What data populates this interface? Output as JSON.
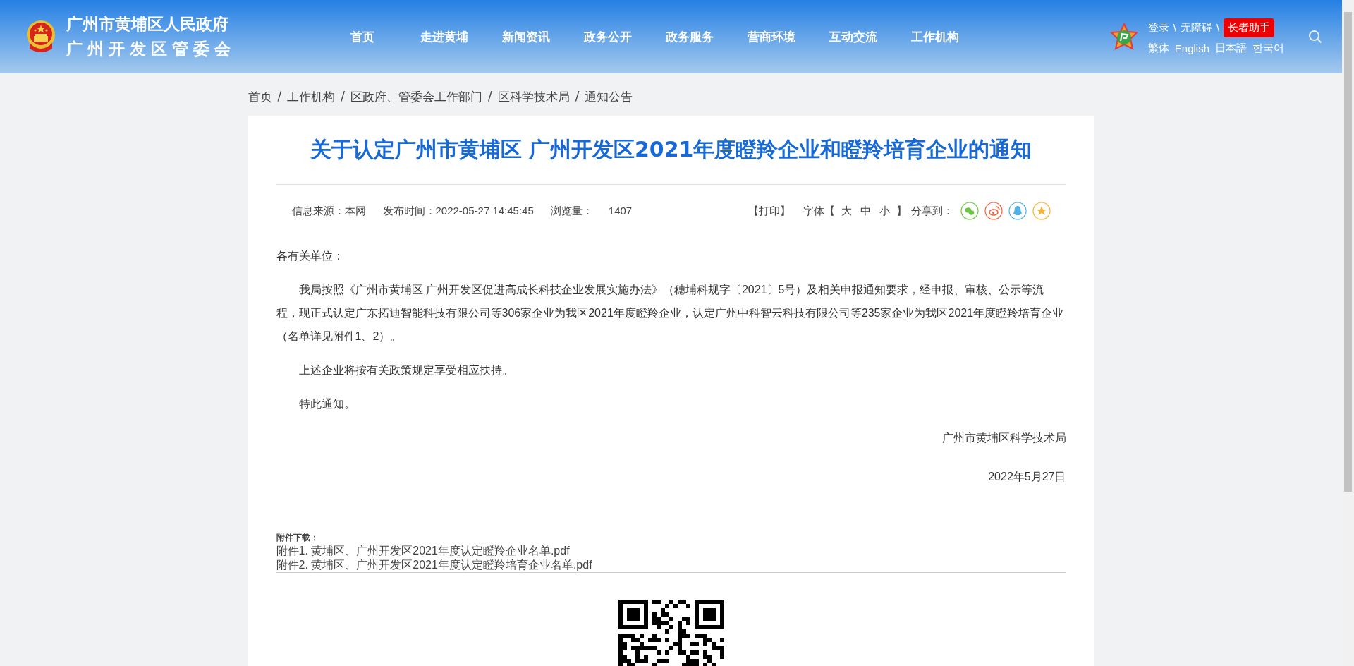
{
  "header": {
    "site_name": "广州市黄埔区人民政府",
    "site_subname": "广州开发区管委会",
    "nav": [
      {
        "label": "首页"
      },
      {
        "label": "走进黄埔"
      },
      {
        "label": "新闻资讯"
      },
      {
        "label": "政务公开"
      },
      {
        "label": "政务服务"
      },
      {
        "label": "营商环境"
      },
      {
        "label": "互动交流"
      },
      {
        "label": "工作机构"
      }
    ],
    "top_links": [
      "登录",
      "\\",
      "无障碍",
      "\\"
    ],
    "elder_button": "长者助手",
    "languages": [
      "繁体",
      "English",
      "日本語",
      "한국어"
    ]
  },
  "breadcrumb": [
    "首页",
    "/",
    "工作机构",
    "/",
    "区政府、管委会工作部门",
    "/",
    "区科学技术局",
    "/",
    "通知公告"
  ],
  "article": {
    "title": "关于认定广州市黄埔区 广州开发区2021年度瞪羚企业和瞪羚培育企业的通知",
    "meta": {
      "source": "信息来源：本网",
      "published": "发布时间：2022-05-27 14:45:45",
      "views_label": "浏览量：",
      "views": "1407"
    },
    "tools": {
      "print": "【打印】",
      "font_label": "字体【",
      "font_sizes": [
        "大",
        "中",
        "小"
      ],
      "font_close": "】",
      "share_label": "分享到："
    },
    "share": [
      {
        "kind": "wechat",
        "color": "#6cc644"
      },
      {
        "kind": "weibo",
        "color": "#f0623c"
      },
      {
        "kind": "qq",
        "color": "#4fb0e8"
      },
      {
        "kind": "favorite",
        "color": "#f5b335"
      }
    ],
    "greeting": "各有关单位：",
    "paragraphs": [
      "我局按照《广州市黄埔区 广州开发区促进高成长科技企业发展实施办法》（穗埔科规字〔2021〕5号）及相关申报通知要求，经申报、审核、公示等流程，现正式认定广东拓迪智能科技有限公司等306家企业为我区2021年度瞪羚企业，认定广州中科智云科技有限公司等235家企业为我区2021年度瞪羚培育企业（名单详见附件1、2）。",
      "上述企业将按有关政策规定享受相应扶持。",
      "特此通知。"
    ],
    "signature": "广州市黄埔区科学技术局",
    "date": "2022年5月27日",
    "attachments_label": "附件下载：",
    "attachments": [
      "附件1. 黄埔区、广州开发区2021年度认定瞪羚企业名单.pdf",
      "附件2. 黄埔区、广州开发区2021年度认定瞪羚培育企业名单.pdf"
    ]
  }
}
